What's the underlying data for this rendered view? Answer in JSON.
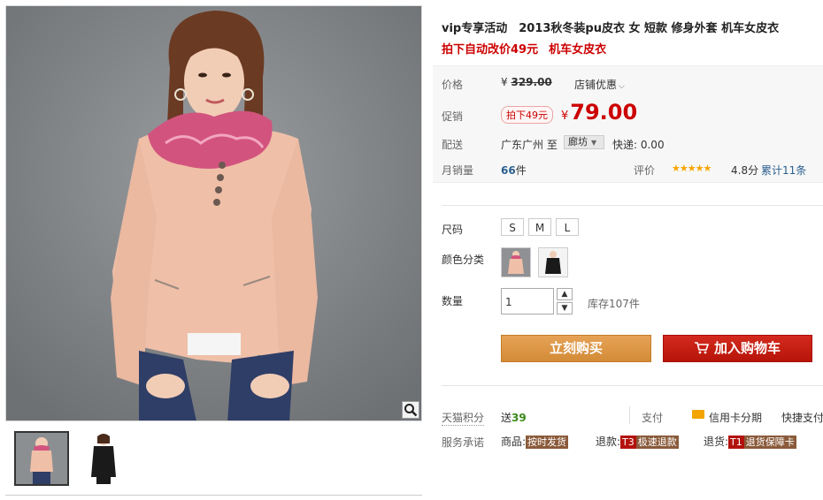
{
  "title": {
    "line1": "vip专享活动　2013秋冬装pu皮衣 女 短款 修身外套 机车女皮衣",
    "line2_a": "拍下自动改价49元",
    "line2_b": "机车女皮衣"
  },
  "price": {
    "label": "价格",
    "currency": "¥",
    "original": "329.00",
    "store_discount": "店铺优惠"
  },
  "promo": {
    "label": "促销",
    "tag": "拍下49元",
    "currency": "¥",
    "price": "79.00"
  },
  "shipping": {
    "label": "配送",
    "from": "广东广州",
    "to_word": "至",
    "city": "廊坊",
    "fee": "快递: 0.00"
  },
  "sales": {
    "label": "月销量",
    "count": "66",
    "unit": "件",
    "rating_label": "评价",
    "stars": "★★★★★",
    "score": "4.8分",
    "total": "累计11条"
  },
  "size": {
    "label": "尺码",
    "options": [
      "S",
      "M",
      "L"
    ]
  },
  "color": {
    "label": "颜色分类"
  },
  "quantity": {
    "label": "数量",
    "value": "1",
    "up": "▲",
    "down": "▼",
    "stock": "库存107件"
  },
  "buttons": {
    "buy": "立刻购买",
    "cart": "加入购物车"
  },
  "points": {
    "label": "天猫积分",
    "prefix": "送",
    "value": "39",
    "pay_label": "支付",
    "credit": "信用卡分期",
    "fast_pay": "快捷支付"
  },
  "service": {
    "label": "服务承诺",
    "goods_label": "商品:",
    "goods_badge": "按时发货",
    "refund_label": "退款:",
    "refund_code": "T3",
    "refund_badge": "极速退款",
    "return_label": "退货:",
    "return_code": "T1",
    "return_badge": "退货保障卡"
  },
  "icons": {
    "zoom": "magnifier-icon",
    "cart": "cart-icon",
    "credit": "credit-card-icon"
  },
  "colors": {
    "accent_red": "#c00000",
    "buy_orange": "#d38b36",
    "cart_red": "#b71409",
    "jacket_pink": "#efbfa8",
    "backdrop_gray": "#808386"
  }
}
